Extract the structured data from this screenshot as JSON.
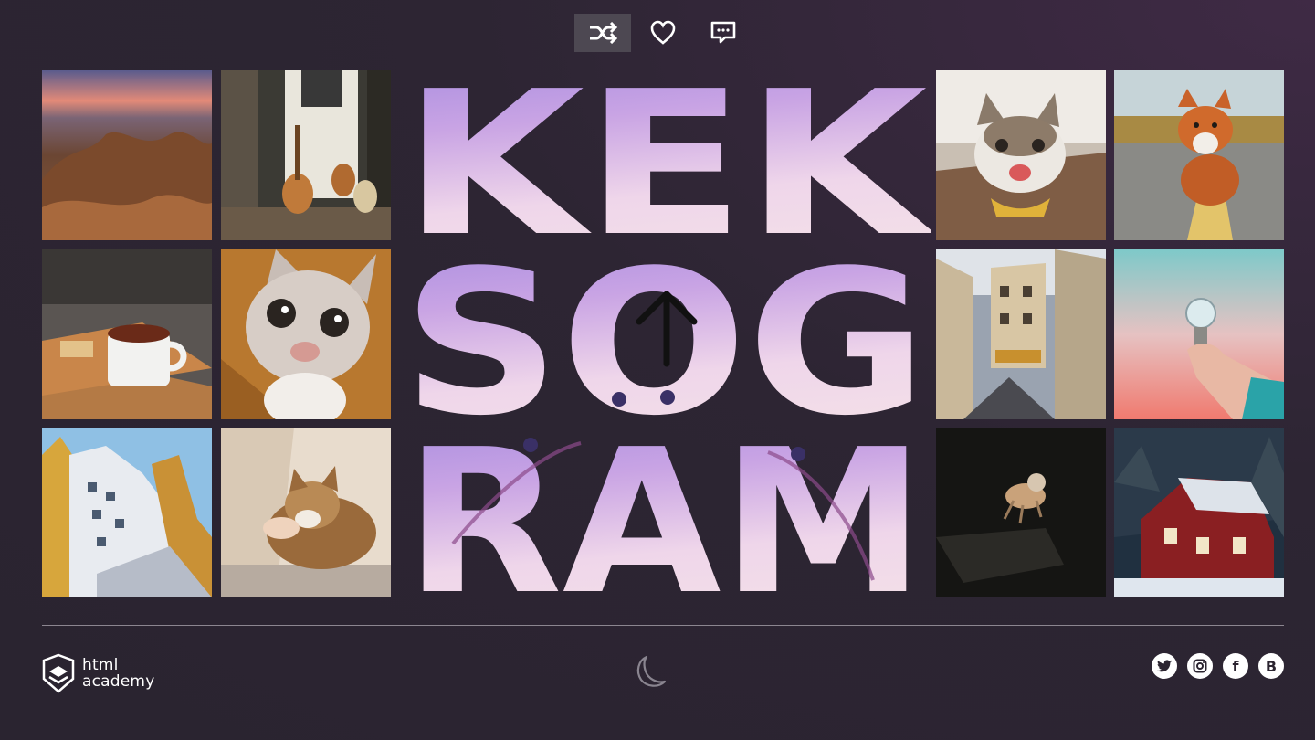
{
  "toolbar": {
    "filters": [
      {
        "icon": "shuffle-icon",
        "state": "active"
      },
      {
        "icon": "heart-icon",
        "state": "inactive"
      },
      {
        "icon": "comment-icon",
        "state": "inactive"
      }
    ]
  },
  "logo": {
    "lines": [
      "KEK",
      "SOG",
      "RAM"
    ],
    "upload_icon": "arrow-up-icon"
  },
  "photos": [
    "desert-rocks",
    "guitars-room",
    "tea-cup",
    "cat-closeup",
    "building-facade",
    "cat-petted",
    "happy-cat",
    "fox-road",
    "paris-street",
    "lightbulb-hand",
    "cat-dark",
    "red-house-snow"
  ],
  "footer": {
    "brand_line1": "html",
    "brand_line2": "academy",
    "theme_icon": "moon-icon",
    "socials": [
      {
        "name": "twitter",
        "glyph": ""
      },
      {
        "name": "instagram",
        "glyph": ""
      },
      {
        "name": "facebook",
        "glyph": "f"
      },
      {
        "name": "vk",
        "glyph": "B"
      }
    ]
  },
  "colors": {
    "background": "#2d2533",
    "filter_active_bg": "#4d4852",
    "logo_gradient_top": "#a58ae0",
    "logo_gradient_bottom": "#f3dfe8"
  }
}
